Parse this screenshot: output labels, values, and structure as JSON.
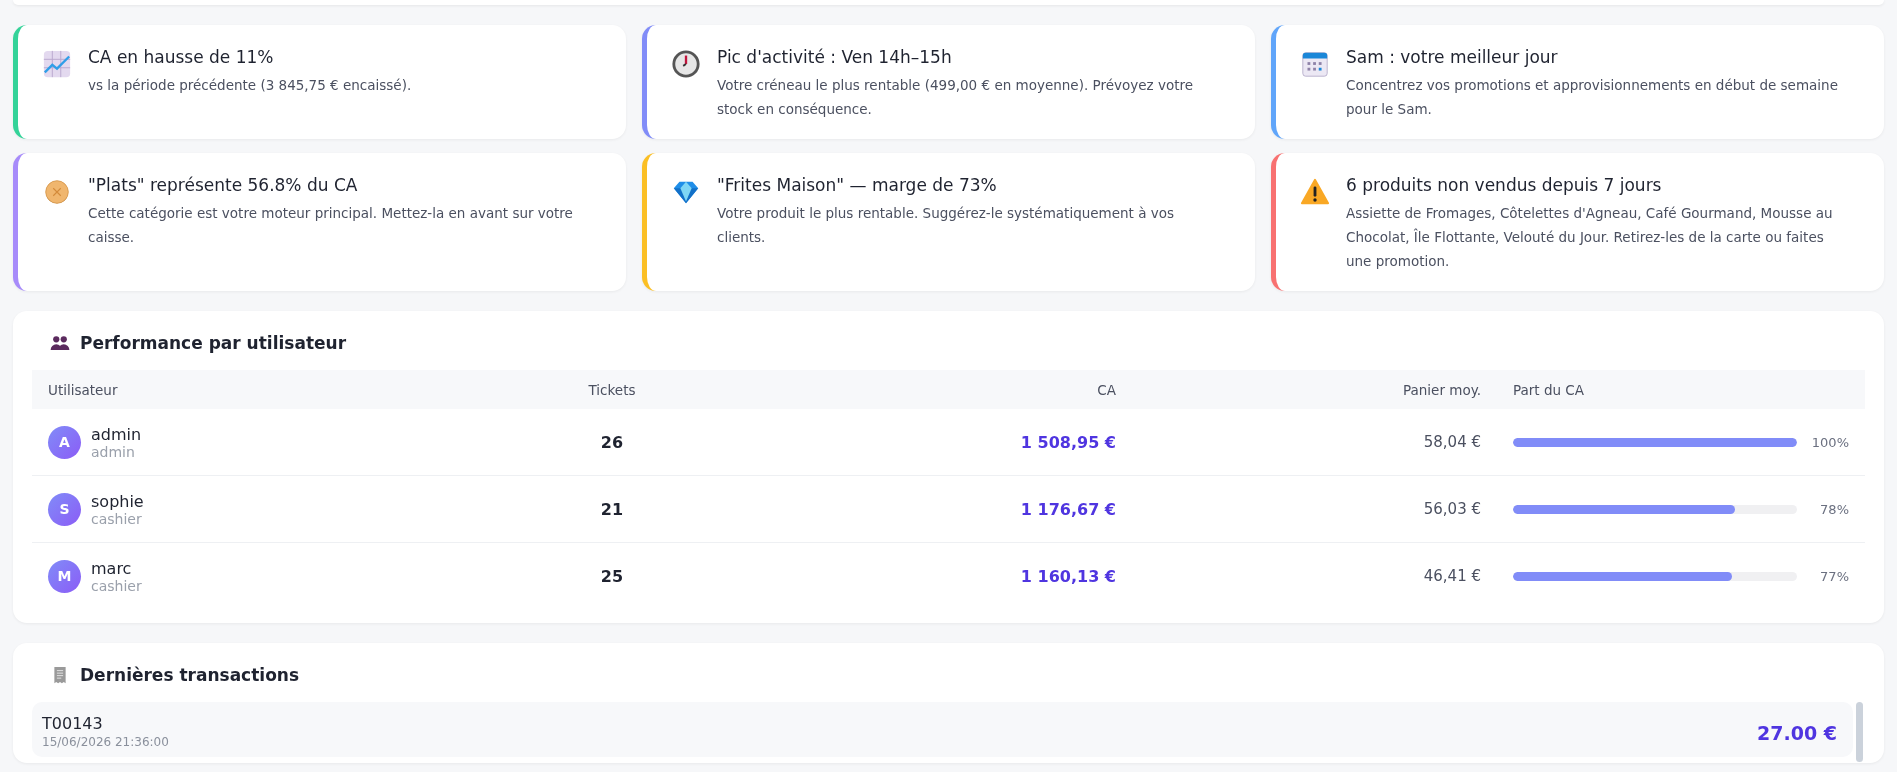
{
  "insights": [
    {
      "kind": "chart",
      "color": "#34d399",
      "title": "CA en hausse de 11%",
      "text": "vs la période précédente (3 845,75 € encaissé)."
    },
    {
      "kind": "clock",
      "color": "#818cf8",
      "title": "Pic d'activité : Ven 14h–15h",
      "text": "Votre créneau le plus rentable (499,00 € en moyenne). Prévoyez votre stock en conséquence."
    },
    {
      "kind": "calendar",
      "color": "#60a5fa",
      "title": "Sam : votre meilleur jour",
      "text": "Concentrez vos promotions et approvisionnements en début de semaine pour le Sam."
    },
    {
      "kind": "pie",
      "color": "#a78bfa",
      "title": "\"Plats\" représente 56.8% du CA",
      "text": "Cette catégorie est votre moteur principal. Mettez-la en avant sur votre caisse."
    },
    {
      "kind": "gem",
      "color": "#fbbf24",
      "title": "\"Frites Maison\" — marge de 73%",
      "text": "Votre produit le plus rentable. Suggérez-le systématiquement à vos clients."
    },
    {
      "kind": "warning",
      "color": "#f87171",
      "title": "6 produits non vendus depuis 7 jours",
      "text": "Assiette de Fromages, Côtelettes d'Agneau, Café Gourmand, Mousse au Chocolat, Île Flottante, Velouté du Jour. Retirez-les de la carte ou faites une promotion."
    }
  ],
  "performance": {
    "title": "Performance par utilisateur",
    "columns": [
      "Utilisateur",
      "Tickets",
      "CA",
      "Panier moy.",
      "Part du CA"
    ],
    "rows": [
      {
        "avatar": "A",
        "name": "admin",
        "role": "admin",
        "tickets": "26",
        "revenue": "1 508,95 €",
        "basket": "58,04 €",
        "level": 1.0,
        "share": "100%"
      },
      {
        "avatar": "S",
        "name": "sophie",
        "role": "cashier",
        "tickets": "21",
        "revenue": "1 176,67 €",
        "basket": "56,03 €",
        "level": 0.78,
        "share": "78%"
      },
      {
        "avatar": "M",
        "name": "marc",
        "role": "cashier",
        "tickets": "25",
        "revenue": "1 160,13 €",
        "basket": "46,41 €",
        "level": 0.77,
        "share": "77%"
      }
    ]
  },
  "transactions": {
    "title": "Dernières transactions",
    "rows": [
      {
        "id": "T00143",
        "date": "15/06/2026 21:36:00",
        "amount": "27.00 €"
      }
    ]
  }
}
